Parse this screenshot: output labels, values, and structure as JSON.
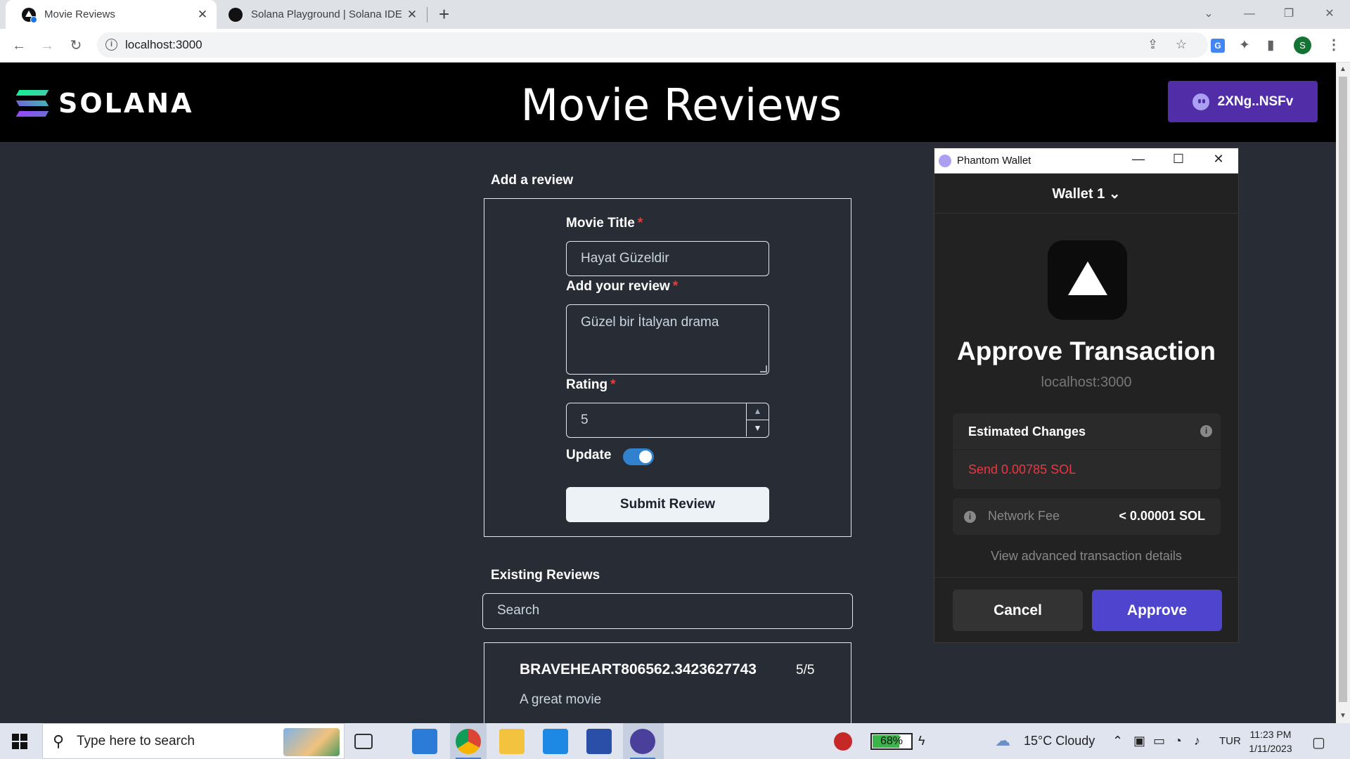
{
  "browser": {
    "tabs": [
      {
        "title": "Movie Reviews",
        "active": true
      },
      {
        "title": "Solana Playground | Solana IDE",
        "active": false
      }
    ],
    "tab_close": "✕",
    "new_tab": "+",
    "url": "localhost:3000"
  },
  "header": {
    "logo_text": "SOLANA",
    "title": "Movie Reviews",
    "wallet_address": "2XNg..NSFv"
  },
  "form": {
    "section_title": "Add a review",
    "title_label": "Movie Title",
    "title_value": "Hayat Güzeldir",
    "review_label": "Add your review",
    "review_value": "Güzel bir İtalyan drama",
    "rating_label": "Rating",
    "rating_value": "5",
    "required_mark": "*",
    "update_label": "Update",
    "update_on": true,
    "submit_label": "Submit Review"
  },
  "existing": {
    "section_title": "Existing Reviews",
    "search_placeholder": "Search",
    "reviews": [
      {
        "title": "BRAVEHEART806562.3423627743",
        "score": "5/5",
        "description": "A great movie"
      }
    ]
  },
  "phantom": {
    "window_title": "Phantom Wallet",
    "wallet_name": "Wallet 1 ⌄",
    "heading": "Approve Transaction",
    "origin": "localhost:3000",
    "estimated_changes_label": "Estimated Changes",
    "send_text": "Send 0.00785 SOL",
    "network_fee_label": "Network Fee",
    "network_fee_value": "< 0.00001 SOL",
    "advanced_link": "View advanced transaction details",
    "cancel_label": "Cancel",
    "approve_label": "Approve",
    "colors": {
      "approve": "#4e44ce",
      "send": "#eb3742"
    }
  },
  "taskbar": {
    "search_placeholder": "Type here to search",
    "battery_percent": "68%",
    "weather": "15°C  Cloudy",
    "language": "TUR",
    "time": "11:23 PM",
    "date": "1/11/2023"
  }
}
